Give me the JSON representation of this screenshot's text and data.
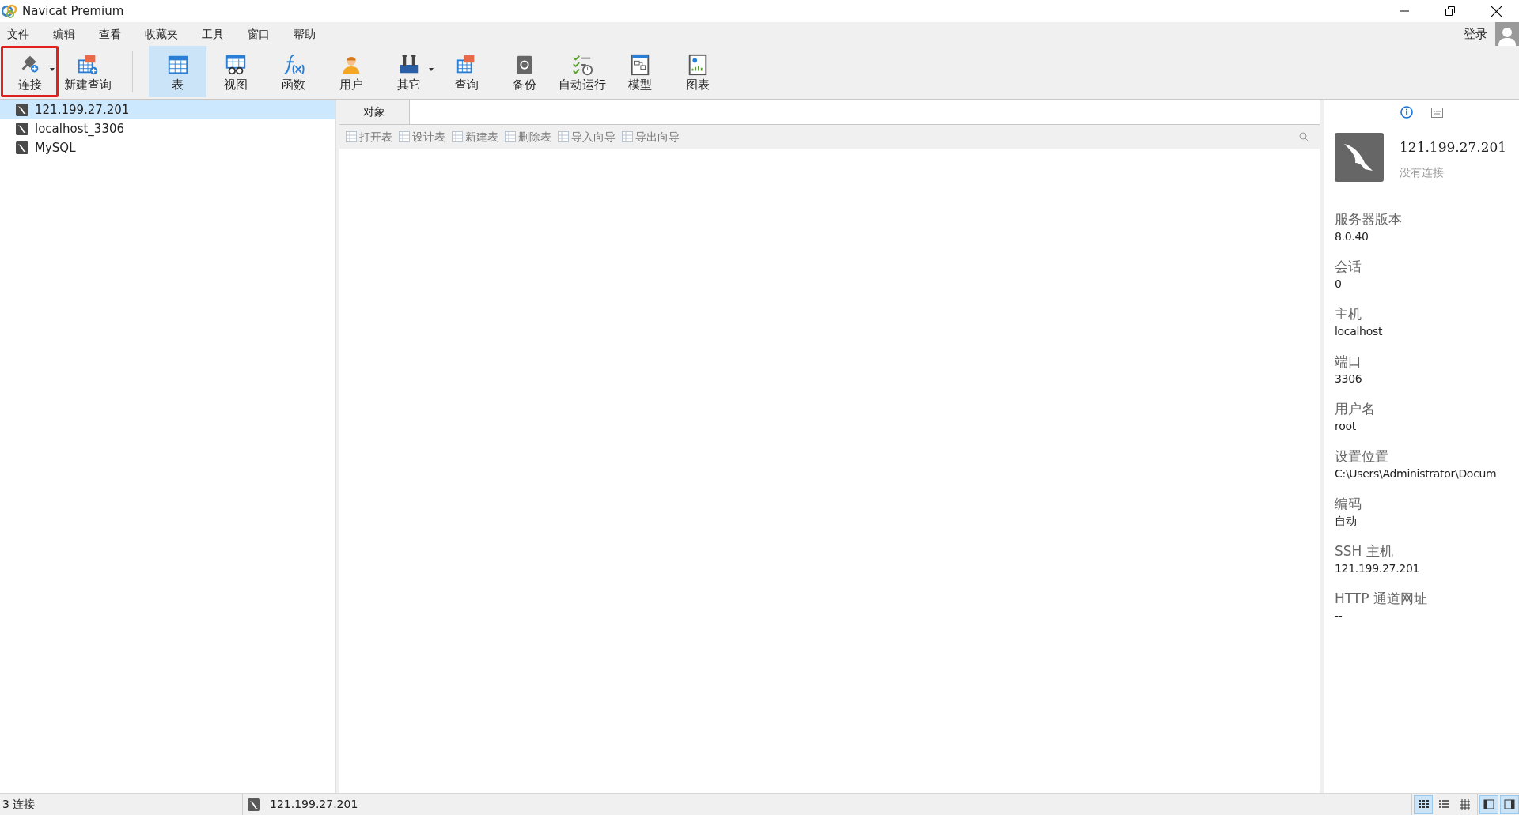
{
  "window": {
    "title": "Navicat Premium"
  },
  "menu": [
    "文件",
    "编辑",
    "查看",
    "收藏夹",
    "工具",
    "窗口",
    "帮助"
  ],
  "login": "登录",
  "toolbar": [
    {
      "label": "连接",
      "selected": false,
      "dropdown": true,
      "highlighted": true
    },
    {
      "label": "新建查询",
      "selected": false,
      "dropdown": false,
      "highlighted": false
    },
    {
      "label": "表",
      "selected": true,
      "dropdown": false,
      "highlighted": false
    },
    {
      "label": "视图",
      "selected": false,
      "dropdown": false,
      "highlighted": false
    },
    {
      "label": "函数",
      "selected": false,
      "dropdown": false,
      "highlighted": false
    },
    {
      "label": "用户",
      "selected": false,
      "dropdown": false,
      "highlighted": false
    },
    {
      "label": "其它",
      "selected": false,
      "dropdown": true,
      "highlighted": false
    },
    {
      "label": "查询",
      "selected": false,
      "dropdown": false,
      "highlighted": false
    },
    {
      "label": "备份",
      "selected": false,
      "dropdown": false,
      "highlighted": false
    },
    {
      "label": "自动运行",
      "selected": false,
      "dropdown": false,
      "highlighted": false
    },
    {
      "label": "模型",
      "selected": false,
      "dropdown": false,
      "highlighted": false
    },
    {
      "label": "图表",
      "selected": false,
      "dropdown": false,
      "highlighted": false
    }
  ],
  "connections": [
    {
      "label": "121.199.27.201",
      "selected": true
    },
    {
      "label": "localhost_3306",
      "selected": false
    },
    {
      "label": "MySQL",
      "selected": false
    }
  ],
  "tabs": [
    {
      "label": "对象",
      "selected": true
    }
  ],
  "object_toolbar": [
    {
      "label": "打开表",
      "disabled": true
    },
    {
      "label": "设计表",
      "disabled": true
    },
    {
      "label": "新建表",
      "disabled": true
    },
    {
      "label": "删除表",
      "disabled": true
    },
    {
      "label": "导入向导",
      "disabled": true
    },
    {
      "label": "导出向导",
      "disabled": true
    }
  ],
  "info_panel": {
    "tabs": [
      {
        "kind": "info",
        "selected": true
      },
      {
        "kind": "ddl",
        "selected": false
      }
    ],
    "name": "121.199.27.201",
    "status": "没有连接",
    "fields": [
      {
        "label": "服务器版本",
        "value": "8.0.40"
      },
      {
        "label": "会话",
        "value": "0"
      },
      {
        "label": "主机",
        "value": "localhost"
      },
      {
        "label": "端口",
        "value": "3306"
      },
      {
        "label": "用户名",
        "value": "root"
      },
      {
        "label": "设置位置",
        "value": "C:\\Users\\Administrator\\Docum"
      },
      {
        "label": "编码",
        "value": "自动"
      },
      {
        "label": "SSH 主机",
        "value": "121.199.27.201"
      },
      {
        "label": "HTTP 通道网址",
        "value": "--"
      }
    ]
  },
  "status_bar": {
    "count": "3 连接",
    "connection": "121.199.27.201",
    "view_buttons": [
      {
        "kind": "list",
        "selected": true
      },
      {
        "kind": "detail",
        "selected": false
      },
      {
        "kind": "er",
        "selected": false
      }
    ],
    "panel_buttons": [
      {
        "kind": "left",
        "selected": true
      },
      {
        "kind": "right",
        "selected": true
      }
    ]
  }
}
